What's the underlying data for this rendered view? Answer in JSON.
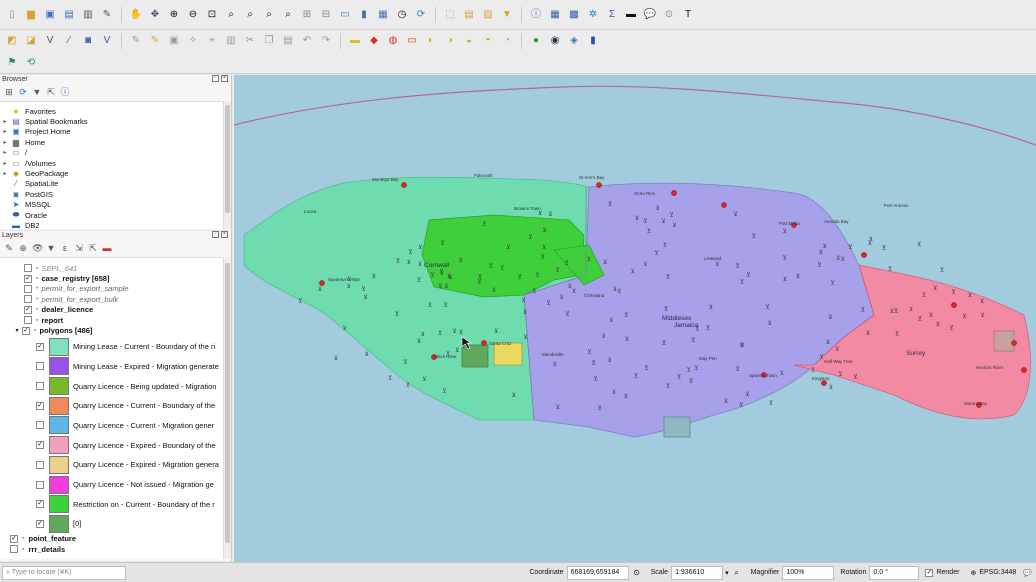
{
  "browser": {
    "title": "Browser",
    "items": [
      {
        "label": "Favorites",
        "icon": "star-icon",
        "expand": false
      },
      {
        "label": "Spatial Bookmarks",
        "icon": "bookmark-icon",
        "expand": true
      },
      {
        "label": "Project Home",
        "icon": "project-home-icon",
        "expand": true
      },
      {
        "label": "Home",
        "icon": "home-folder-icon",
        "expand": true
      },
      {
        "label": "/",
        "icon": "folder-icon",
        "expand": true
      },
      {
        "label": "/Volumes",
        "icon": "folder-icon",
        "expand": true
      },
      {
        "label": "GeoPackage",
        "icon": "geopackage-icon",
        "expand": true
      },
      {
        "label": "SpatiaLite",
        "icon": "spatialite-icon",
        "expand": false
      },
      {
        "label": "PostGIS",
        "icon": "postgis-icon",
        "expand": false
      },
      {
        "label": "MSSQL",
        "icon": "mssql-icon",
        "expand": false
      },
      {
        "label": "Oracle",
        "icon": "oracle-icon",
        "expand": false
      },
      {
        "label": "DB2",
        "icon": "db2-icon",
        "expand": false
      }
    ]
  },
  "layers": {
    "title": "Layers",
    "rows": [
      {
        "label": "SEPL_641",
        "checked": false,
        "style": "g",
        "expand": false
      },
      {
        "label": "case_registry [658]",
        "checked": true,
        "style": "b",
        "expand": false
      },
      {
        "label": "permit_for_export_sample",
        "checked": false,
        "style": "i",
        "expand": false
      },
      {
        "label": "permit_for_export_bulk",
        "checked": false,
        "style": "i",
        "expand": false
      },
      {
        "label": "dealer_licence",
        "checked": true,
        "style": "b",
        "expand": false
      },
      {
        "label": "report",
        "checked": false,
        "style": "b",
        "expand": false
      },
      {
        "label": "polygons [486]",
        "checked": true,
        "style": "b",
        "expand": true
      }
    ],
    "legend": [
      {
        "label": "Mining Lease - Current - Boundary of the ri",
        "checked": true,
        "color": "#7fe0c2"
      },
      {
        "label": "Mining Lease - Expired - Migration generate",
        "checked": false,
        "color": "#9a52e6"
      },
      {
        "label": "Quarry Licence - Being updated - Migration",
        "checked": false,
        "color": "#78b82c"
      },
      {
        "label": "Quarry Licence - Current - Boundary of the",
        "checked": true,
        "color": "#ef8a5a"
      },
      {
        "label": "Quarry Licence - Current - Migration gener",
        "checked": false,
        "color": "#5cb8e8"
      },
      {
        "label": "Quarry Licence - Expired - Boundary of the",
        "checked": true,
        "color": "#f3a0bb"
      },
      {
        "label": "Quarry Licence - Expired - Migration genera",
        "checked": false,
        "color": "#ead08a"
      },
      {
        "label": "Quarry Licence - Not issued - Migration ge",
        "checked": false,
        "color": "#f03ddb"
      },
      {
        "label": "Restriction on - Current - Boundary of the r",
        "checked": true,
        "color": "#3ed23a"
      },
      {
        "label": "[0]",
        "checked": true,
        "color": "#5fa85c"
      }
    ],
    "bottom_rows": [
      {
        "label": "point_feature",
        "checked": true
      },
      {
        "label": "rrr_details",
        "checked": false
      }
    ]
  },
  "map": {
    "place_labels": [
      "Montego Bay",
      "Falmouth",
      "Lucea",
      "Savanna-la-Mar",
      "Black River",
      "Santa Cruz",
      "Mandeville",
      "Christiana",
      "May Pen",
      "Spanish Town",
      "Port Maria",
      "Annotto Bay",
      "Port Antonio",
      "Morant Bay",
      "Kingston",
      "Linstead",
      "Ocho Rios",
      "St Ann's Bay",
      "Browns Town",
      "Half Way Tree",
      "Cornwall",
      "Middlesex",
      "Jamaica",
      "Surrey",
      "Hectors River"
    ],
    "colors": {
      "sea": "#a2ccdd",
      "cornwall": "#6fdcb0",
      "middlesex": "#a7a0ea",
      "surrey": "#f38aa4",
      "restriction": "#3ecf3a",
      "quarry": "#ead860"
    }
  },
  "status": {
    "search_placeholder": "Type to locate (⌘K)",
    "coordinate_label": "Coordinate",
    "coordinate_value": "668169,659184",
    "scale_label": "Scale",
    "scale_value": "1:936610",
    "magnifier_label": "Magnifier",
    "magnifier_value": "100%",
    "rotation_label": "Rotation",
    "rotation_value": "0.0 °",
    "render_label": "Render",
    "crs_label": "EPSG:3448"
  }
}
